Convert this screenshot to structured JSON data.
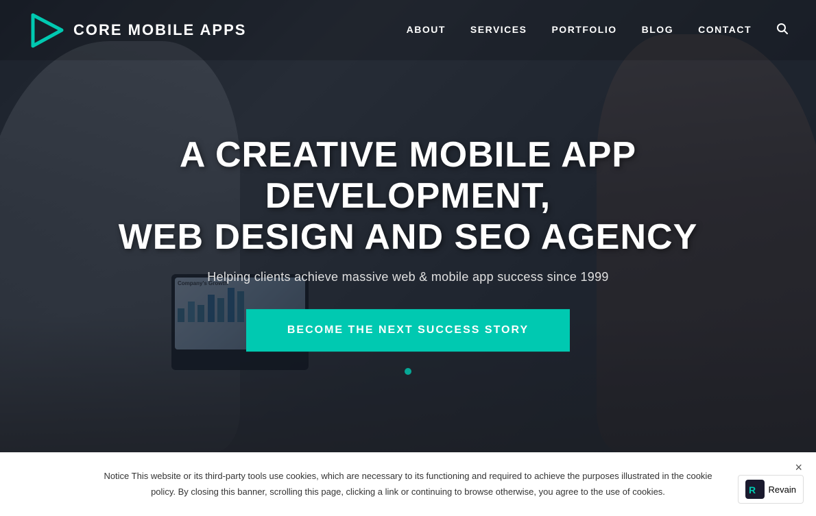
{
  "brand": {
    "name": "CORE MOBILE APPS",
    "logo_alt": "Core Mobile Apps Logo"
  },
  "nav": {
    "links": [
      {
        "label": "ABOUT",
        "href": "#"
      },
      {
        "label": "SERVICES",
        "href": "#"
      },
      {
        "label": "PORTFOLIO",
        "href": "#"
      },
      {
        "label": "BLOG",
        "href": "#"
      },
      {
        "label": "CONTACT",
        "href": "#"
      }
    ],
    "search_label": "Search"
  },
  "hero": {
    "title_line1": "A CREATIVE MOBILE APP DEVELOPMENT,",
    "title_line2": "WEB DESIGN AND SEO AGENCY",
    "subtitle": "Helping clients achieve massive web & mobile app success since 1999",
    "cta_label": "BECOME THE NEXT SUCCESS STORY"
  },
  "laptop": {
    "chart_title": "Company's Growth"
  },
  "cookie": {
    "text": "Notice This website or its third-party tools use cookies, which are necessary to its functioning and required to achieve the purposes illustrated in the cookie policy. By closing this banner, scrolling this page, clicking a link or continuing to browse otherwise, you agree to the use of cookies.",
    "close_label": "×"
  },
  "revain": {
    "brand": "Revain"
  }
}
